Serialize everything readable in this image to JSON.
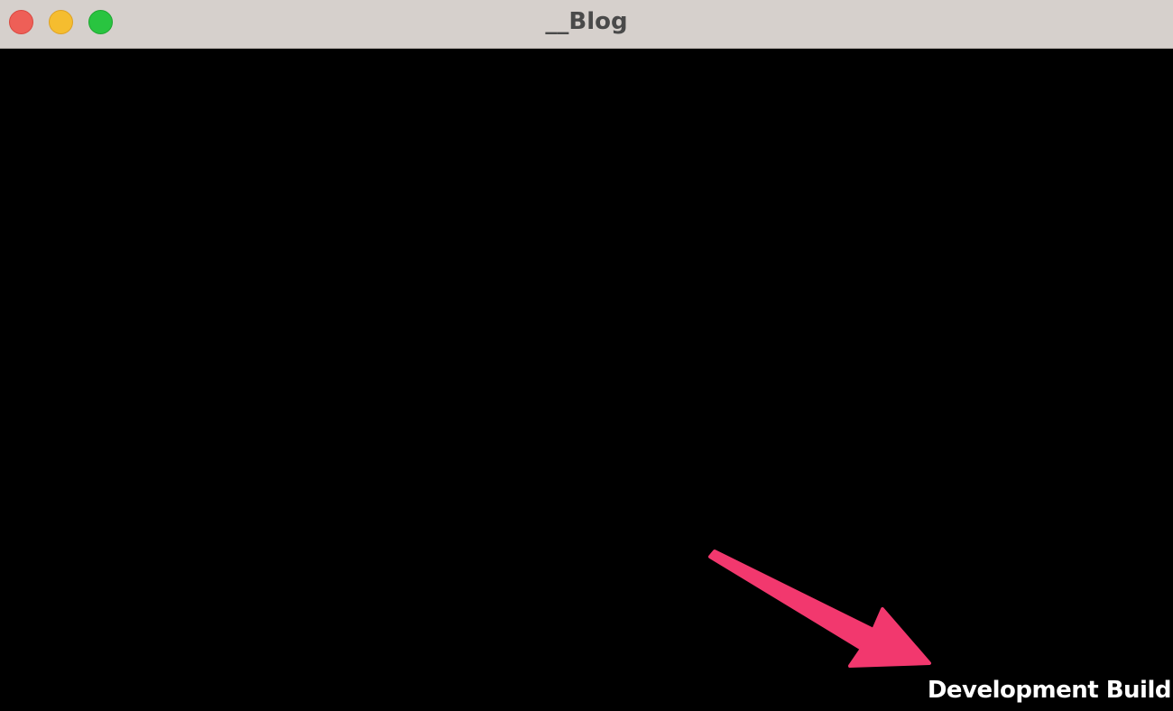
{
  "window": {
    "title": "__Blog",
    "controls": {
      "close_color": "#ee5f57",
      "minimize_color": "#f5bd2f",
      "zoom_color": "#29c440"
    }
  },
  "game_view": {
    "background": "#000000",
    "watermark": "Development Build"
  },
  "annotation": {
    "icon": "arrow-icon",
    "color": "#f2386e"
  }
}
